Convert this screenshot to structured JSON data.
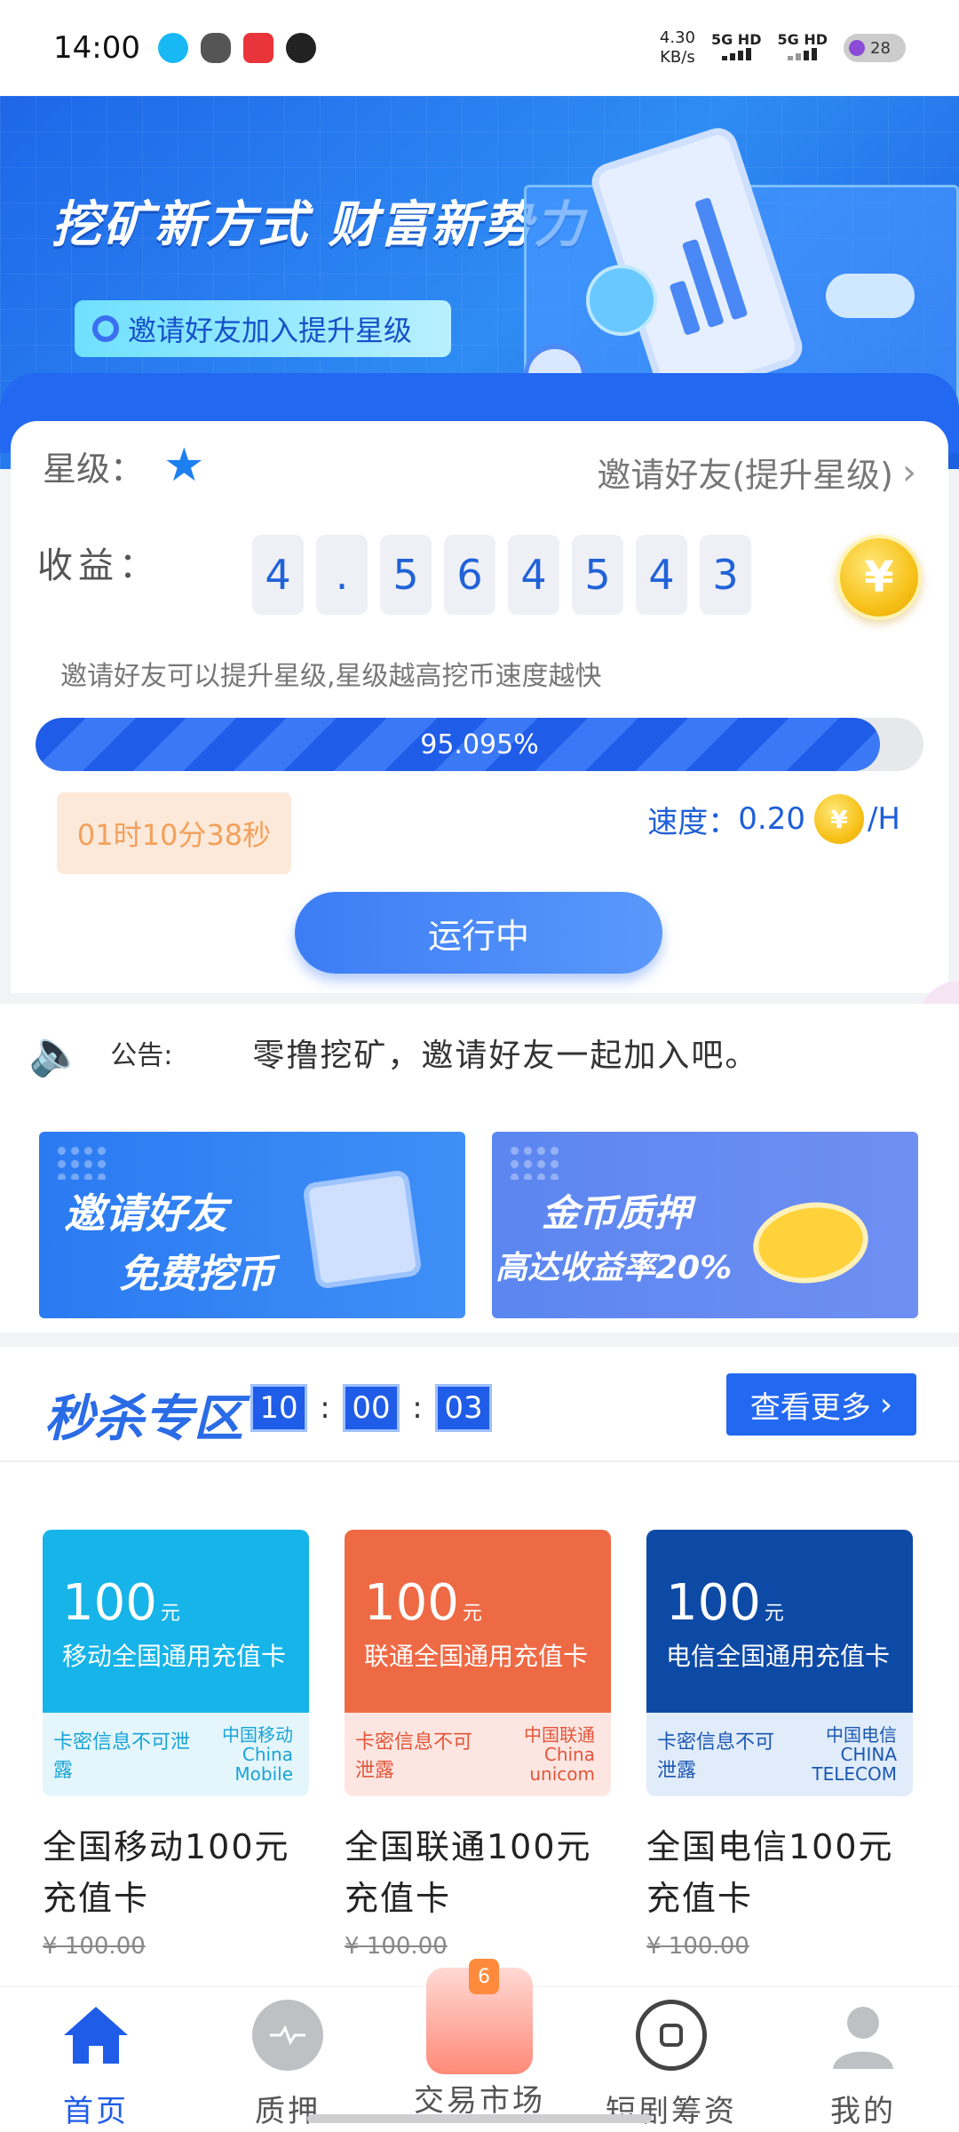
{
  "status_bar": {
    "time": "14:00",
    "net_speed": "4.30",
    "net_unit": "KB/s",
    "sim1": "5G HD",
    "sim2": "5G HD",
    "battery": "28"
  },
  "banner": {
    "title": "挖矿新方式 财富新势力",
    "pill": "邀请好友加入提升星级"
  },
  "mining": {
    "star_label": "星级：",
    "invite_link": "邀请好友(提升星级)",
    "income_label": "收益：",
    "income_digits": [
      "4",
      ".",
      "5",
      "6",
      "4",
      "5",
      "4",
      "3"
    ],
    "coin_symbol": "¥",
    "tip": "邀请好友可以提升星级,星级越高挖币速度越快",
    "progress_percent": 95.095,
    "progress_text": "95.095%",
    "countdown": "01时10分38秒",
    "speed_label": "速度：",
    "speed_value": "0.20",
    "speed_unit": "/H",
    "run_button": "运行中"
  },
  "notice": {
    "label": "公告:",
    "text": "零撸挖矿，邀请好友一起加入吧。"
  },
  "promos": [
    {
      "line1": "邀请好友",
      "line2": "免费挖币"
    },
    {
      "line1": "金币质押",
      "line2": "高达收益率20%"
    }
  ],
  "flash_sale": {
    "title": "秒杀专区",
    "hours": "10",
    "minutes": "00",
    "seconds": "03",
    "more": "查看更多"
  },
  "products": [
    {
      "amount": "100",
      "unit": "元",
      "card_name": "移动全国通用充值卡",
      "note": "卡密信息不可泄露",
      "logo": "中国移动",
      "logo_en": "China Mobile",
      "title": "全国移动100元充值卡",
      "price": "¥ 100.00"
    },
    {
      "amount": "100",
      "unit": "元",
      "card_name": "联通全国通用充值卡",
      "note": "卡密信息不可泄露",
      "logo": "中国联通",
      "logo_en": "China unicom",
      "title": "全国联通100元充值卡",
      "price": "¥ 100.00"
    },
    {
      "amount": "100",
      "unit": "元",
      "card_name": "电信全国通用充值卡",
      "note": "卡密信息不可泄露",
      "logo": "中国电信",
      "logo_en": "CHINA TELECOM",
      "title": "全国电信100元充值卡",
      "price": "¥ 100.00"
    }
  ],
  "bottom_nav": [
    {
      "label": "首页",
      "icon": "home-icon",
      "active": true
    },
    {
      "label": "质押",
      "icon": "pulse-icon",
      "active": false
    },
    {
      "label": "交易市场",
      "icon": "market-icon",
      "active": false,
      "badge": "6"
    },
    {
      "label": "短剧筹资",
      "icon": "square-ring-icon",
      "active": false
    },
    {
      "label": "我的",
      "icon": "user-icon",
      "active": false
    }
  ],
  "colors": {
    "primary": "#2368f0",
    "accent_orange": "#f2a05a",
    "coin": "#f7c21b"
  }
}
